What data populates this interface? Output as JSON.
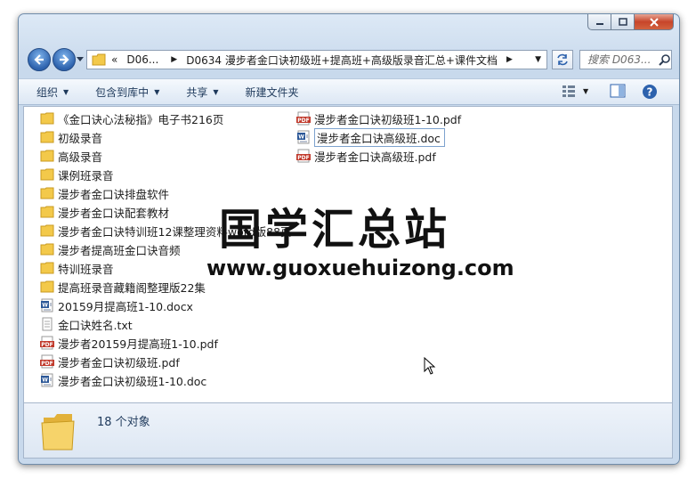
{
  "window": {
    "title": "D0634 漫步者金口诀初级班+提高班+高级版录音汇总+课件文档"
  },
  "address": {
    "prefix": "«",
    "crumb_short": "D06...",
    "crumb_full": "D0634 漫步者金口诀初级班+提高班+高级版录音汇总+课件文档"
  },
  "search": {
    "placeholder": "搜索 D063..."
  },
  "toolbar": {
    "organize": "组织",
    "include_in_library": "包含到库中",
    "share": "共享",
    "new_folder": "新建文件夹"
  },
  "files": {
    "left": [
      {
        "name": "《金口诀心法秘指》电子书216页",
        "icon": "folder"
      },
      {
        "name": "初级录音",
        "icon": "folder"
      },
      {
        "name": "高级录音",
        "icon": "folder"
      },
      {
        "name": "课例班录音",
        "icon": "folder"
      },
      {
        "name": "漫步者金口诀排盘软件",
        "icon": "folder"
      },
      {
        "name": "漫步者金口诀配套教材",
        "icon": "folder"
      },
      {
        "name": "漫步者金口诀特训班12课整理资料word版88页",
        "icon": "folder"
      },
      {
        "name": "漫步者提高班金口诀音频",
        "icon": "folder"
      },
      {
        "name": "特训班录音",
        "icon": "folder"
      },
      {
        "name": "提高班录音藏籍阁整理版22集",
        "icon": "folder"
      },
      {
        "name": "20159月提高班1-10.docx",
        "icon": "word"
      },
      {
        "name": "金口诀姓名.txt",
        "icon": "txt"
      },
      {
        "name": "漫步者20159月提高班1-10.pdf",
        "icon": "pdf"
      },
      {
        "name": "漫步者金口诀初级班.pdf",
        "icon": "pdf"
      },
      {
        "name": "漫步者金口诀初级班1-10.doc",
        "icon": "word"
      }
    ],
    "right": [
      {
        "name": "漫步者金口诀初级班1-10.pdf",
        "icon": "pdf"
      },
      {
        "name": "漫步者金口诀高级班.doc",
        "icon": "word"
      },
      {
        "name": "漫步者金口诀高级班.pdf",
        "icon": "pdf"
      }
    ]
  },
  "watermark": {
    "title": "国学汇总站",
    "url": "www.guoxuehuizong.com"
  },
  "status": {
    "count": "18 个对象"
  },
  "colors": {
    "folder": "#f3c94a",
    "pdf": "#c0392b",
    "word": "#2b5797",
    "accent": "#1e395b"
  }
}
